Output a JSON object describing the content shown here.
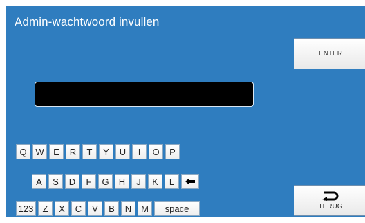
{
  "title": "Admin-wachtwoord invullen",
  "password": {
    "value": ""
  },
  "buttons": {
    "enter": "ENTER",
    "terug": "TERUG"
  },
  "keyboard": {
    "row1": [
      "Q",
      "W",
      "E",
      "R",
      "T",
      "Y",
      "U",
      "I",
      "O",
      "P"
    ],
    "row2": [
      "A",
      "S",
      "D",
      "F",
      "G",
      "H",
      "J",
      "K",
      "L"
    ],
    "row3": [
      "123",
      "Z",
      "X",
      "C",
      "V",
      "B",
      "N",
      "M",
      "space"
    ]
  },
  "icons": {
    "backspace": "backspace-arrow-icon",
    "back": "return-arrow-icon"
  },
  "colors": {
    "panel": "#2f7dbf",
    "field": "#000000",
    "key": "#ffffff"
  }
}
